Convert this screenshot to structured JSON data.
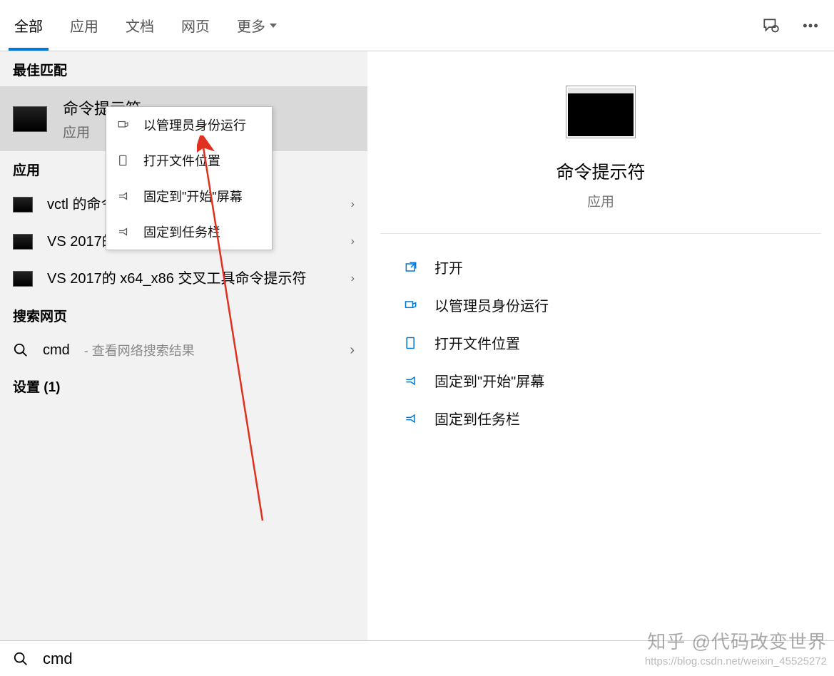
{
  "header": {
    "tabs": [
      "全部",
      "应用",
      "文档",
      "网页"
    ],
    "more": "更多"
  },
  "left": {
    "best_match_header": "最佳匹配",
    "best_match": {
      "title": "命令提示符",
      "subtitle": "应用"
    },
    "apps_header": "应用",
    "apps": [
      "vctl 的命令提示符",
      "VS 2017的开发人员命令提示符",
      "VS 2017的 x64_x86 交叉工具命令提示符"
    ],
    "web_header": "搜索网页",
    "web": {
      "query": "cmd",
      "hint": "- 查看网络搜索结果"
    },
    "settings_header": "设置 (1)"
  },
  "context_menu": [
    "以管理员身份运行",
    "打开文件位置",
    "固定到\"开始\"屏幕",
    "固定到任务栏"
  ],
  "detail": {
    "title": "命令提示符",
    "subtitle": "应用",
    "actions": [
      "打开",
      "以管理员身份运行",
      "打开文件位置",
      "固定到\"开始\"屏幕",
      "固定到任务栏"
    ]
  },
  "search": {
    "value": "cmd"
  },
  "watermark": {
    "main": "知乎 @代码改变世界",
    "sub": "https://blog.csdn.net/weixin_45525272"
  }
}
